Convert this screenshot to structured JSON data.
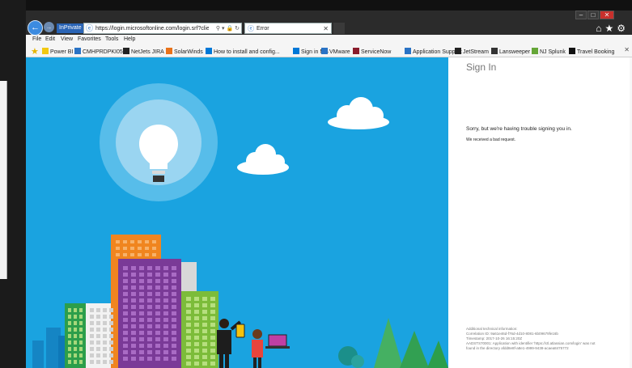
{
  "browser": {
    "inprivate_label": "InPrivate",
    "address_url": "https://login.microsoftonline.com/login.srf?clie",
    "tab_title": "Error"
  },
  "menu": [
    "File",
    "Edit",
    "View",
    "Favorites",
    "Tools",
    "Help"
  ],
  "favorites": [
    {
      "label": "Power BI",
      "icon": "bar-chart-icon",
      "color": "#f2c811"
    },
    {
      "label": "CMHPRDPKI05",
      "icon": "ie-page-icon",
      "color": "#2a73c5"
    },
    {
      "label": "NetJets JIRA",
      "icon": "jira-icon",
      "color": "#222222"
    },
    {
      "label": "SolarWinds",
      "icon": "solarwinds-icon",
      "color": "#e9721a"
    },
    {
      "label": "How to install and config...",
      "icon": "windows-logo-icon",
      "color": "#0078d7"
    },
    {
      "label": "Sign in MS",
      "icon": "windows-logo-icon",
      "color": "#0078d7"
    },
    {
      "label": "VMware",
      "icon": "ie-page-icon",
      "color": "#2a73c5"
    },
    {
      "label": "ServiceNow",
      "icon": "servicenow-icon",
      "color": "#8a1c2c"
    },
    {
      "label": "Application Support",
      "icon": "ie-page-icon",
      "color": "#2a73c5"
    },
    {
      "label": "JetStream",
      "icon": "jetstream-icon",
      "color": "#222222"
    },
    {
      "label": "Lansweeper",
      "icon": "lansweeper-icon",
      "color": "#333333"
    },
    {
      "label": "NJ Splunk",
      "icon": "splunk-icon",
      "color": "#65a637"
    },
    {
      "label": "Travel Booking",
      "icon": "travel-icon",
      "color": "#111111"
    }
  ],
  "signin": {
    "title": "Sign In",
    "message": "Sorry, but we're having trouble signing you in.",
    "submessage": "We received a bad request.",
    "technical": [
      "Additional technical information:",
      "Correlation ID: 9a61e46d-f76d-4d10-8081-6b09679fe16b",
      "Timestamp: 2017-10-26 16:15:20Z",
      "AADSTS70001: Application with identifier 'https://ctl.atlassian.com/login' was not",
      "found in the directory afdd8e8f-a8e1-4999-9438-acaea8475772"
    ]
  },
  "colors": {
    "hero_background": "#1aa3e0",
    "accent": "#2a64b5"
  }
}
